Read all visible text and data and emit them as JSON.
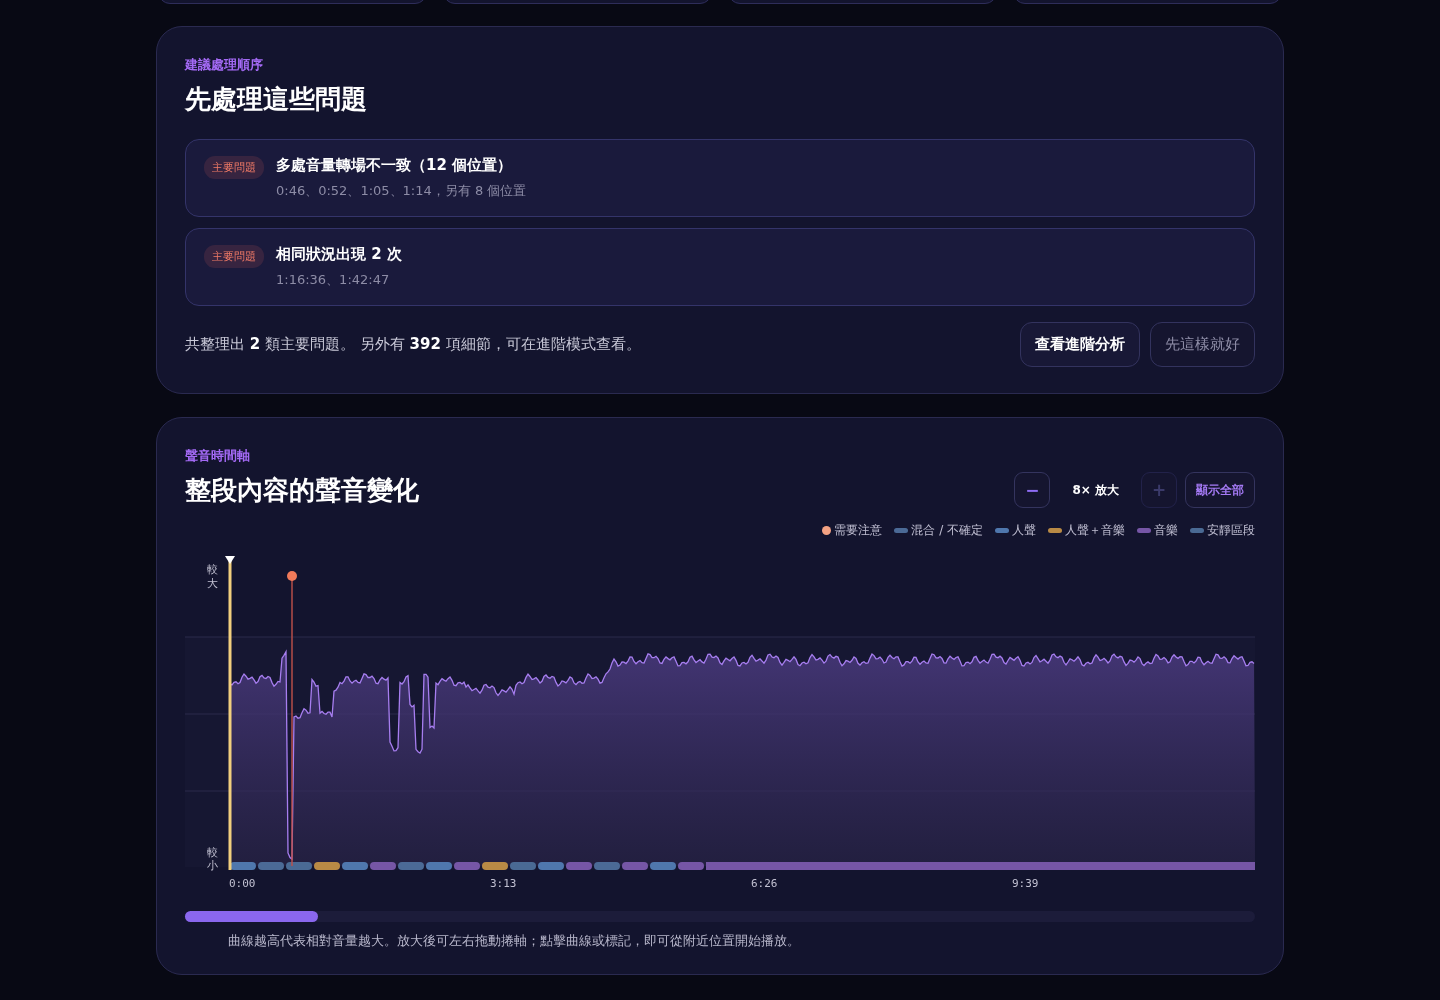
{
  "priority_panel": {
    "eyebrow": "建議處理順序",
    "title": "先處理這些問題",
    "issues": [
      {
        "badge": "主要問題",
        "title": "多處音量轉場不一致（12 個位置）",
        "detail": "0:46、0:52、1:05、1:14，另有 8 個位置"
      },
      {
        "badge": "主要問題",
        "title": "相同狀況出現 2 次",
        "detail": "1:16:36、1:42:47"
      }
    ],
    "summary": "共整理出 **2** 類主要問題。 另外有 **392** 項細節，可在進階模式查看。",
    "buttons": [
      {
        "label": "查看進階分析",
        "kind": "primary"
      },
      {
        "label": "先這樣就好",
        "kind": "secondary"
      }
    ]
  },
  "timeline_panel": {
    "eyebrow": "聲音時間軸",
    "title": "整段內容的聲音變化",
    "zoom": {
      "minus": {
        "label": "−",
        "disabled": false
      },
      "level_label": "8× 放大",
      "plus": {
        "label": "+",
        "disabled": true
      },
      "show_all": "顯示全部"
    },
    "legend": [
      {
        "label": "需要注意",
        "kind": "dot",
        "color": "#f4a283"
      },
      {
        "label": "混合 / 不確定",
        "kind": "line",
        "color": "#4b6a96"
      },
      {
        "label": "人聲",
        "kind": "line",
        "color": "#4f77ad"
      },
      {
        "label": "人聲＋音樂",
        "kind": "line",
        "color": "#b98a45"
      },
      {
        "label": "音樂",
        "kind": "line",
        "color": "#7656a6"
      },
      {
        "label": "安靜區段",
        "kind": "line",
        "color": "#4a6a94"
      }
    ],
    "y_axis": {
      "top": "較大",
      "bottom": "較小"
    },
    "x_axis": [
      "0:00",
      "3:13",
      "6:26",
      "9:39"
    ],
    "caption": "曲線越高代表相對音量越大。放大後可左右拖動捲軸；點擊曲線或標記，即可從附近位置開始播放。"
  }
}
